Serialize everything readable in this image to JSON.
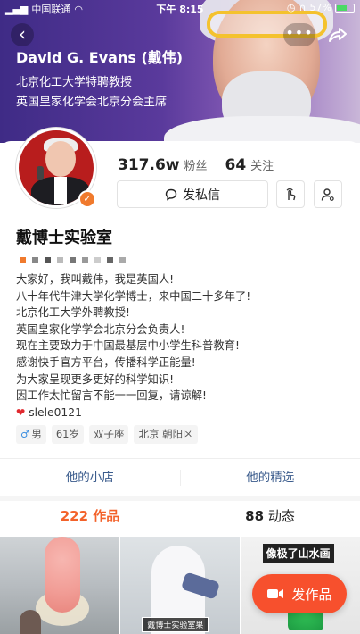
{
  "status_bar": {
    "carrier": "中国联通",
    "time": "下午 8:15",
    "battery": "57%",
    "battery_level": 0.57
  },
  "banner": {
    "name": "David G. Evans (戴伟)",
    "line1": "北京化工大学特聘教授",
    "line2": "英国皇家化学会北京分会主席"
  },
  "profile": {
    "followers_value": "317.6w",
    "followers_label": "粉丝",
    "following_value": "64",
    "following_label": "关注",
    "message_button": "发私信",
    "title": "戴博士实验室",
    "bio": [
      "大家好，我叫戴伟，我是英国人!",
      "八十年代牛津大学化学博士，来中国二十多年了!",
      "北京化工大学外聘教授!",
      "英国皇家化学学会北京分会负责人!",
      "现在主要致力于中国最基层中小学生科普教育!",
      "感谢快手官方平台，传播科学正能量!",
      "为大家呈现更多更好的科学知识!",
      "因工作太忙留言不能一一回复，请谅解!"
    ],
    "bio_link": "slele0121",
    "tags": {
      "gender": "男",
      "age": "61岁",
      "zodiac": "双子座",
      "location": "北京 朝阳区"
    }
  },
  "shop": {
    "store": "他的小店",
    "picks": "他的精选"
  },
  "tabs": {
    "works_count": "222",
    "works_label": "作品",
    "moments_count": "88",
    "moments_label": "动态"
  },
  "videos": {
    "caption_2": "戴博士实验室果",
    "title_3": "像极了山水画"
  },
  "publish_button": "发作品",
  "colors": {
    "accent": "#f3622a",
    "publish": "#f7502d",
    "link_blue": "#3a5b8c",
    "verified": "#f07a2d"
  }
}
